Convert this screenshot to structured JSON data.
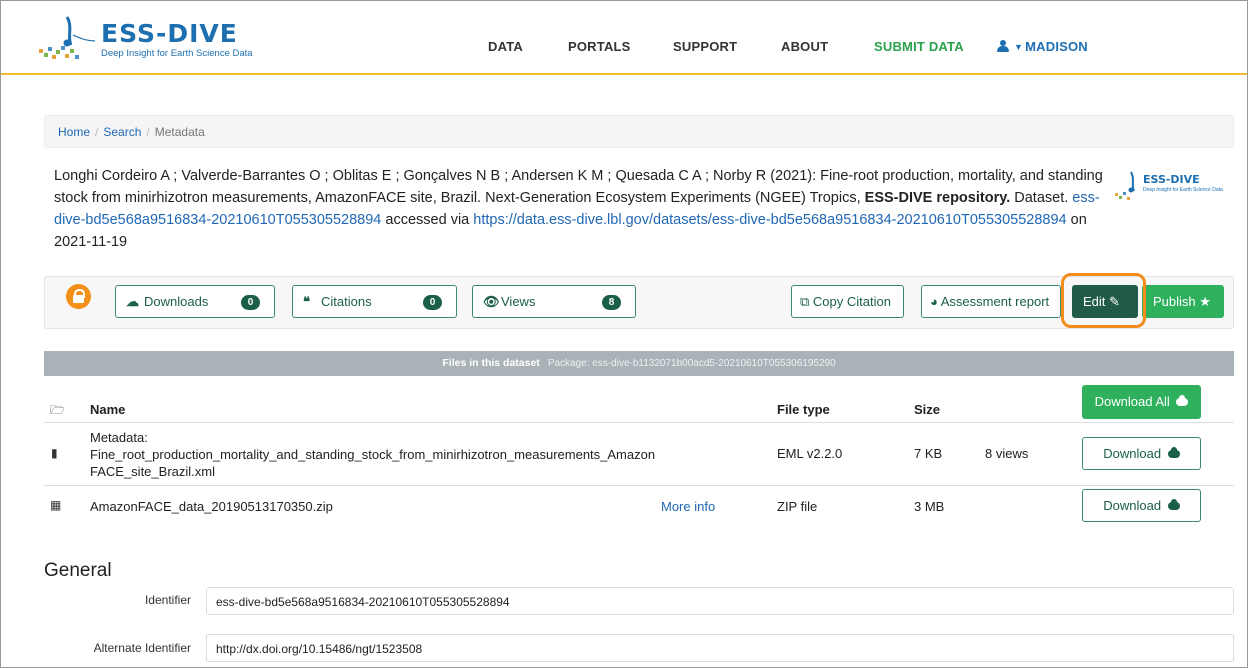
{
  "header": {
    "logo_title": "ESS-DIVE",
    "logo_subtitle": "Deep Insight for Earth Science Data",
    "nav": [
      {
        "label": "DATA"
      },
      {
        "label": "PORTALS"
      },
      {
        "label": "SUPPORT"
      },
      {
        "label": "ABOUT"
      },
      {
        "label": "SUBMIT DATA"
      }
    ],
    "user_label": "MADISON"
  },
  "breadcrumb": {
    "home": "Home",
    "search": "Search",
    "current": "Metadata"
  },
  "citation": {
    "authors_title": "Longhi Cordeiro A ; Valverde-Barrantes O ; Oblitas E ; Gonçalves N B ; Andersen K M ; Quesada C A ; Norby R (2021): Fine-root production, mortality, and standing stock from minirhizotron measurements, AmazonFACE site, Brazil. Next-Generation Ecosystem Experiments (NGEE) Tropics, ",
    "repository": "ESS-DIVE repository.",
    "dataset_text": " Dataset. ",
    "identifier": "ess-dive-bd5e568a9516834-20210610T055305528894",
    "accessed_via": " accessed via ",
    "url": "https://data.ess-dive.lbl.gov/datasets/ess-dive-bd5e568a9516834-20210610T055305528894",
    "accessed_on": " on 2021-11-19",
    "logo_title": "ESS-DIVE",
    "logo_subtitle": "Deep Insight for Earth Science Data"
  },
  "metrics": {
    "downloads_label": "Downloads",
    "downloads_count": "0",
    "citations_label": "Citations",
    "citations_count": "0",
    "views_label": "Views",
    "views_count": "8"
  },
  "actions": {
    "copy_citation": "Copy Citation",
    "assessment_report": "Assessment report",
    "edit": "Edit",
    "publish": "Publish"
  },
  "files": {
    "header_title": "Files in this dataset",
    "package_label": "Package: ess-dive-b1132071b00acd5-20210610T055306195290",
    "columns": {
      "name": "Name",
      "file_type": "File type",
      "size": "Size"
    },
    "download_all": "Download All",
    "rows": [
      {
        "name_line1": "Metadata:",
        "name_line2": "Fine_root_production_mortality_and_standing_stock_from_minirhizotron_measurements_Amazon",
        "name_line3": "FACE_site_Brazil.xml",
        "more_info": "",
        "file_type": "EML v2.2.0",
        "size": "7 KB",
        "views": "8 views",
        "download": "Download"
      },
      {
        "name_line1": "AmazonFACE_data_20190513170350.zip",
        "more_info": "More info",
        "file_type": "ZIP file",
        "size": "3 MB",
        "views": "",
        "download": "Download"
      }
    ]
  },
  "general": {
    "title": "General",
    "fields": [
      {
        "label": "Identifier",
        "value": "ess-dive-bd5e568a9516834-20210610T055305528894"
      },
      {
        "label": "Alternate Identifier",
        "value": "http://dx.doi.org/10.15486/ngt/1523508"
      }
    ]
  },
  "colors": {
    "brand_blue": "#1d6faf",
    "accent_green": "#2fb05c",
    "dark_green": "#1f5b48",
    "highlight_orange": "#f28c1a",
    "header_border": "#f0ba2d"
  }
}
